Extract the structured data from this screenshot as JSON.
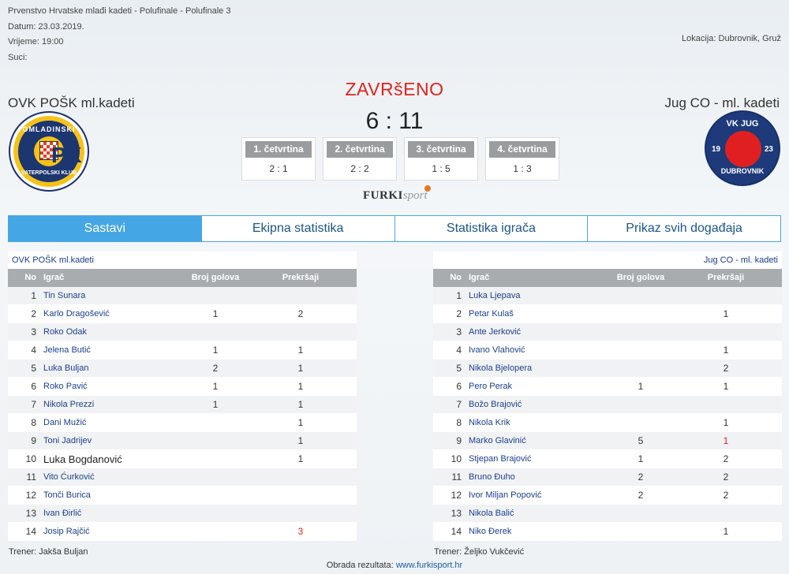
{
  "match": {
    "competition": "Prvenstvo Hrvatske mlađi kadeti - Polufinale - Polufinale 3",
    "date": "Datum: 23.03.2019.",
    "time": "Vrijeme: 19:00",
    "referees": "Suci:",
    "location": "Lokacija: Dubrovnik, Gruž",
    "status": "ZAVRšENO",
    "score": "6 : 11"
  },
  "teams": {
    "home": {
      "name": "OVK POŠK ml.kadeti",
      "logo_text_top": "OMLADINSKI",
      "logo_text_bottom": "VATERPOLSKI KLUB",
      "logo_mark": "PK"
    },
    "away": {
      "name": "Jug CO - ml. kadeti",
      "logo_text_top": "VK JUG",
      "logo_text_bottom": "DUBROVNIK",
      "logo_year_left": "19",
      "logo_year_right": "23"
    }
  },
  "quarters": [
    {
      "label": "1. četvrtina",
      "score": "2 : 1"
    },
    {
      "label": "2. četvrtina",
      "score": "2 : 2"
    },
    {
      "label": "3. četvrtina",
      "score": "1 : 5"
    },
    {
      "label": "4. četvrtina",
      "score": "1 : 3"
    }
  ],
  "brand": {
    "part1": "FURKI",
    "part2": "sport"
  },
  "tabs": [
    {
      "label": "Sastavi",
      "active": true
    },
    {
      "label": "Ekipna statistika"
    },
    {
      "label": "Statistika igrača"
    },
    {
      "label": "Prikaz svih događaja"
    }
  ],
  "table_headers": {
    "no": "No",
    "player": "Igrač",
    "goals": "Broj golova",
    "fouls": "Prekršaji"
  },
  "home_roster": {
    "title": "OVK POŠK ml.kadeti",
    "coach": "Trener: Jakša Buljan",
    "players": [
      {
        "no": "1",
        "name": "Tin Sunara",
        "goals": "",
        "fouls": ""
      },
      {
        "no": "2",
        "name": "Karlo Dragošević",
        "goals": "1",
        "fouls": "2"
      },
      {
        "no": "3",
        "name": "Roko Odak",
        "goals": "",
        "fouls": ""
      },
      {
        "no": "4",
        "name": "Jelena Butić",
        "goals": "1",
        "fouls": "1"
      },
      {
        "no": "5",
        "name": "Luka Buljan",
        "goals": "2",
        "fouls": "1"
      },
      {
        "no": "6",
        "name": "Roko Pavić",
        "goals": "1",
        "fouls": "1"
      },
      {
        "no": "7",
        "name": "Nikola Prezzi",
        "goals": "1",
        "fouls": "1"
      },
      {
        "no": "8",
        "name": "Dani Mužić",
        "goals": "",
        "fouls": "1"
      },
      {
        "no": "9",
        "name": "Toni Jadrijev",
        "goals": "",
        "fouls": "1"
      },
      {
        "no": "10",
        "name": "Luka Bogdanović",
        "goals": "",
        "fouls": "1"
      },
      {
        "no": "11",
        "name": "Vito Ćurković",
        "goals": "",
        "fouls": ""
      },
      {
        "no": "12",
        "name": "Tonči Burica",
        "goals": "",
        "fouls": ""
      },
      {
        "no": "13",
        "name": "Ivan Đirlić",
        "goals": "",
        "fouls": ""
      },
      {
        "no": "14",
        "name": "Josip Rajčić",
        "goals": "",
        "fouls": "3"
      }
    ]
  },
  "away_roster": {
    "title": "Jug CO - ml. kadeti",
    "coach": "Trener: Željko Vukčević",
    "players": [
      {
        "no": "1",
        "name": "Luka Ljepava",
        "goals": "",
        "fouls": ""
      },
      {
        "no": "2",
        "name": "Petar Kulaš",
        "goals": "",
        "fouls": "1"
      },
      {
        "no": "3",
        "name": "Ante Jerković",
        "goals": "",
        "fouls": ""
      },
      {
        "no": "4",
        "name": "Ivano Vlahović",
        "goals": "",
        "fouls": "1"
      },
      {
        "no": "5",
        "name": "Nikola Bjelopera",
        "goals": "",
        "fouls": "2"
      },
      {
        "no": "6",
        "name": "Pero Perak",
        "goals": "1",
        "fouls": "1"
      },
      {
        "no": "7",
        "name": "Božo Brajović",
        "goals": "",
        "fouls": ""
      },
      {
        "no": "8",
        "name": "Nikola Krik",
        "goals": "",
        "fouls": "1"
      },
      {
        "no": "9",
        "name": "Marko Glavinić",
        "goals": "5",
        "fouls": "1"
      },
      {
        "no": "10",
        "name": "Stjepan Brajović",
        "goals": "1",
        "fouls": "2"
      },
      {
        "no": "11",
        "name": "Bruno Đuho",
        "goals": "2",
        "fouls": "2"
      },
      {
        "no": "12",
        "name": "Ivor Miljan Popović",
        "goals": "2",
        "fouls": "2"
      },
      {
        "no": "13",
        "name": "Nikola Balić",
        "goals": "",
        "fouls": ""
      },
      {
        "no": "14",
        "name": "Niko Đerek",
        "goals": "",
        "fouls": "1"
      }
    ]
  },
  "footer": {
    "label": "Obrada rezultata:",
    "link": "www.furkisport.hr"
  }
}
